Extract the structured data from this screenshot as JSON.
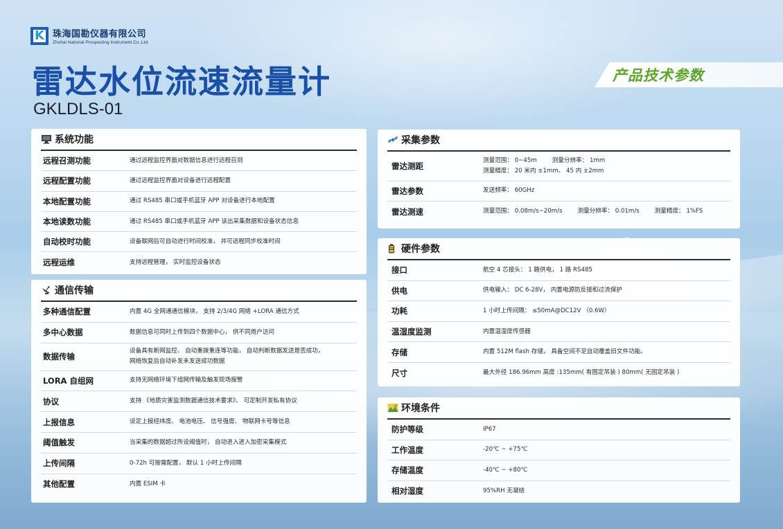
{
  "company": {
    "name_cn": "珠海国勘仪器有限公司",
    "name_en": "Zhuhai National Prospecting Instrument Co.,Ltd.",
    "logo_letter": "K"
  },
  "title": "雷达水位流速流量计",
  "model": "GKLDLS-01",
  "banner": "产品技术参数",
  "accent_colors": {
    "title": "#1a4fa8",
    "banner_text": "#5fa52a"
  },
  "system": {
    "heading": "系统功能",
    "icon": "monitor-icon",
    "rows": [
      {
        "label": "远程召测功能",
        "value": "通过远程监控界面对数据信息进行远程召测"
      },
      {
        "label": "远程配置功能",
        "value": "通过远程监控界面对设备进行远程配置"
      },
      {
        "label": "本地配置功能",
        "value": "通过 RS485 串口或手机蓝牙 APP 对设备进行本地配置"
      },
      {
        "label": "本地读数功能",
        "value": "通过 RS485 串口或手机蓝牙 APP 读出采集数据和设备状态信息"
      },
      {
        "label": "自动校时功能",
        "value": "设备联网后可自动进行时间校准， 并可远程同步校准时间"
      },
      {
        "label": "远程运维",
        "value": "支持远程管理， 实时监控设备状态"
      }
    ]
  },
  "comm": {
    "heading": "通信传输",
    "icon": "satellite-dish-icon",
    "rows": [
      {
        "label": "多种通信配置",
        "value": "内置 4G 全网通通信模块， 支持 2/3/4G 网络 +LORA 通信方式"
      },
      {
        "label": "多中心数据",
        "value": "数据信息可同时上传到四个数据中心， 供不同用户访问"
      },
      {
        "label": "数据传输",
        "value": "设备具有断网监控、 自动重拨重连等功能， 自动判断数据发送是否成功，",
        "value2": "网络恢复后自动补发未发送成功数据"
      },
      {
        "label": "LORA 自组网",
        "value": "支持无网络环境下组网传输及触发现场报警"
      },
      {
        "label": "协议",
        "value": "支持 《地质灾害监测数据通信技术要求》、 可定制开发私有协议"
      },
      {
        "label": "上报信息",
        "value": "设定上报经纬度、 电池电压、 信号强度、 物联网卡号等信息"
      },
      {
        "label": "阈值触发",
        "value": "当采集的数据超过所设阈值时， 自动进入进入加密采集模式"
      },
      {
        "label": "上传间隔",
        "value": "0-72h 可按需配置， 默认 1 小时上传间隔"
      },
      {
        "label": "其他配置",
        "value": "内置 ESIM 卡"
      }
    ]
  },
  "collect": {
    "heading": "采集参数",
    "icon": "satellite-icon",
    "rows": [
      {
        "label": "雷达测距",
        "parts": [
          "测量范围： 0~45m",
          "测量分辨率： 1mm"
        ],
        "parts2": [
          "测量精度： 20 米内 ±1mm、 45 内 ±2mm"
        ]
      },
      {
        "label": "雷达参数",
        "parts": [
          "发送频率： 60GHz"
        ]
      },
      {
        "label": "雷达测速",
        "parts": [
          "测量范围： 0.08m/s~20m/s",
          "测量分辨率： 0.01m/s",
          "测量精度： 1%FS"
        ]
      }
    ]
  },
  "hardware": {
    "heading": "硬件参数",
    "icon": "battery-icon",
    "rows": [
      {
        "label": "接口",
        "value": "航空 4 芯接头： 1 路供电， 1 路 RS485"
      },
      {
        "label": "供电",
        "value": "供电输入： DC 6-28V， 内置电源防反接和过流保护"
      },
      {
        "label": "功耗",
        "value": "1 小时上传间隔： ≤50mA@DC12V （0.6W）"
      },
      {
        "label": "温湿度监测",
        "value": "内置温湿度传感器"
      },
      {
        "label": "存储",
        "value": "内置 512M flash 存储， 具备空间不足自动覆盖旧文件功能。"
      },
      {
        "label": "尺寸",
        "value": "最大外径 186.96mm    高度 :135mm( 有固定吊装 )   80mm( 无固定吊装 )"
      }
    ]
  },
  "environment": {
    "heading": "环境条件",
    "icon": "landscape-icon",
    "rows": [
      {
        "label": "防护等级",
        "value": "IP67"
      },
      {
        "label": "工作温度",
        "value": "-20℃ ~ +75℃"
      },
      {
        "label": "存储温度",
        "value": "-40℃ ~ +80℃"
      },
      {
        "label": "相对湿度",
        "value": "95%RH 无凝结"
      }
    ]
  }
}
